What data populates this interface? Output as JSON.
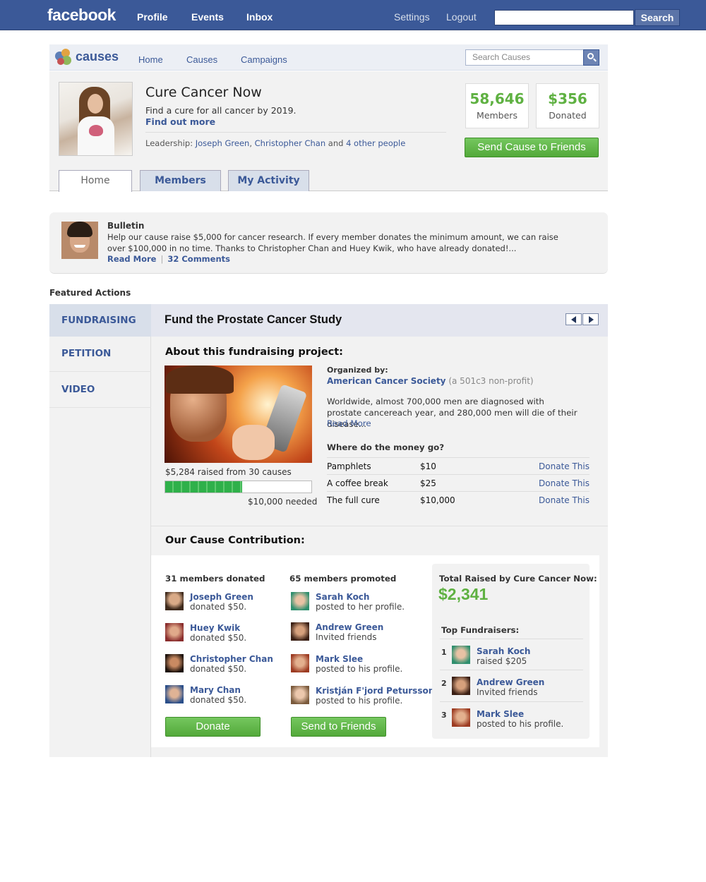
{
  "fb": {
    "logo": "facebook",
    "nav": [
      "Profile",
      "Events",
      "Inbox"
    ],
    "settings": "Settings",
    "logout": "Logout",
    "search_value": "",
    "search_button": "Search"
  },
  "causes_bar": {
    "logo_text": "causes",
    "nav": [
      "Home",
      "Causes",
      "Campaigns"
    ],
    "search_placeholder": "Search Causes"
  },
  "cause": {
    "title": "Cure Cancer Now",
    "tagline": "Find a cure for all cancer by 2019.",
    "find_out_more": "Find out more",
    "leadership_label": "Leadership:",
    "leaders": [
      "Joseph Green",
      "Christopher Chan"
    ],
    "leadership_and": "and",
    "others": "4 other people",
    "members_count": "58,646",
    "members_label": "Members",
    "donated_amount": "$356",
    "donated_label": "Donated",
    "send_button": "Send Cause to Friends"
  },
  "tabs": [
    "Home",
    "Members",
    "My Activity"
  ],
  "bulletin": {
    "title": "Bulletin",
    "text": "Help our cause raise $5,000 for cancer research. If every member donates the minimum amount, we can raise over $100,000 in no time. Thanks to Christopher Chan and Huey Kwik, who have already donated!...",
    "read_more": "Read More",
    "comments": "32 Comments"
  },
  "featured": {
    "label": "Featured Actions",
    "side_items": [
      "FUNDRAISING",
      "PETITION",
      "VIDEO"
    ],
    "title": "Fund the Prostate Cancer Study",
    "about_heading": "About this fundraising project:",
    "raised_text": "$5,284 raised from 30 causes",
    "progress_fraction": 0.5284,
    "needed_text": "$10,000 needed",
    "organized_label": "Organized by:",
    "organization": "American Cancer Society",
    "org_type": "(a 501c3 non-profit)",
    "description": "Worldwide, almost 700,000 men are diagnosed with prostate cancereach year, and 280,000 men will die of their disease...",
    "read_more": "Read More",
    "money_heading": "Where do the money go?",
    "money_rows": [
      {
        "item": "Pamphlets",
        "amount": "$10",
        "action": "Donate This"
      },
      {
        "item": "A coffee break",
        "amount": "$25",
        "action": "Donate This"
      },
      {
        "item": "The full cure",
        "amount": "$10,000",
        "action": "Donate This"
      }
    ]
  },
  "contribution": {
    "heading": "Our Cause Contribution:",
    "donated_header": "31 members donated",
    "donors": [
      {
        "name": "Joseph Green",
        "action": "donated $50."
      },
      {
        "name": "Huey Kwik",
        "action": "donated $50."
      },
      {
        "name": "Christopher Chan",
        "action": "donated $50."
      },
      {
        "name": "Mary Chan",
        "action": "donated $50."
      }
    ],
    "promoted_header": "65 members promoted",
    "promoters": [
      {
        "name": "Sarah Koch",
        "action": "posted to her profile."
      },
      {
        "name": "Andrew Green",
        "action": "Invited friends"
      },
      {
        "name": "Mark Slee",
        "action": "posted to his profile."
      },
      {
        "name": "Kristján F'jord Petursson",
        "action": "posted to his profile."
      }
    ],
    "donate_button": "Donate",
    "send_button": "Send to Friends",
    "total_label": "Total Raised by Cure Cancer Now:",
    "total_value": "$2,341",
    "top_label": "Top Fundraisers:",
    "top": [
      {
        "rank": "1",
        "name": "Sarah Koch",
        "action": "raised $205"
      },
      {
        "rank": "2",
        "name": "Andrew Green",
        "action": "Invited friends"
      },
      {
        "rank": "3",
        "name": "Mark Slee",
        "action": "posted to his profile."
      }
    ]
  },
  "colors": {
    "facebook_blue": "#3b5998",
    "accent_green": "#5fb142",
    "panel_grey": "#f2f2f2"
  }
}
